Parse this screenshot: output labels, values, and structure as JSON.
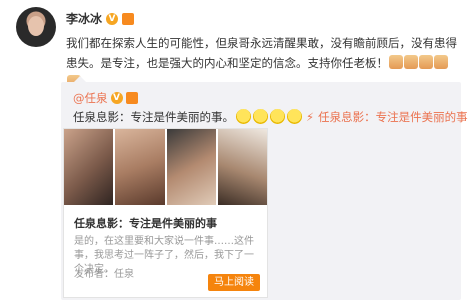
{
  "post": {
    "author": "李冰冰",
    "vip_badge": "V",
    "text": "我们都在探索人生的可能性，但泉哥永远清醒果敢，没有瞻前顾后，没有患得患失。是专注，也是强大的内心和坚定的信念。支持你任老板！",
    "emojis": [
      "clap-emoji",
      "clap-emoji",
      "clap-emoji",
      "clap-emoji",
      "clap-emoji"
    ]
  },
  "repost": {
    "author": "@任泉",
    "vip_badge": "V",
    "text": "任泉息影：专注是件美丽的事。",
    "emojis": [
      "smile-emoji",
      "smile-emoji",
      "smile-emoji",
      "smile-emoji"
    ],
    "link_text": "任泉息影：专注是件美丽的事",
    "card": {
      "title": "任泉息影：专注是件美丽的事",
      "description": "是的，在这里要和大家说一件事……这件事，我思考过一阵子了，然后，我下了一个决定。",
      "publisher": "发布者：任泉",
      "button": "马上阅读"
    }
  },
  "colors": {
    "accent": "#eb7350",
    "button": "#f5840d",
    "repost_bg": "#f2f2f5"
  }
}
